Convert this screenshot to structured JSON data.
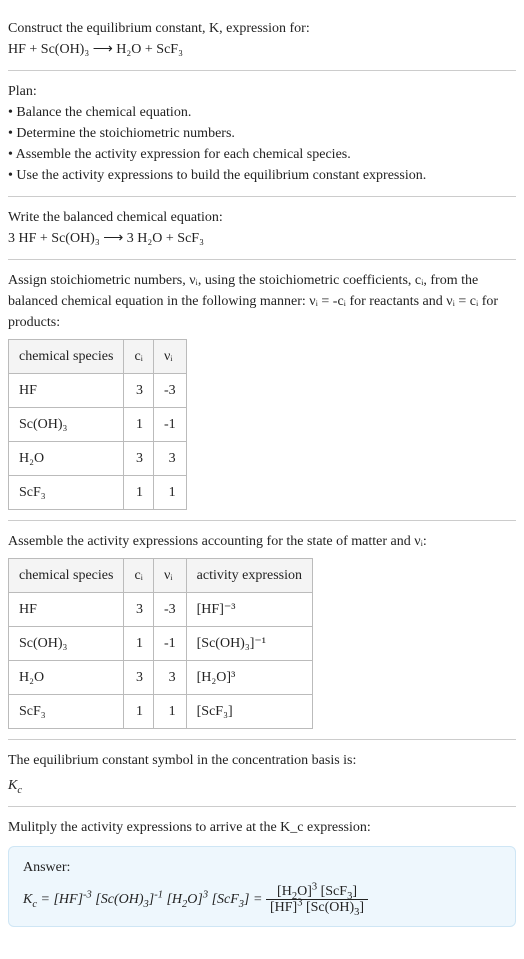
{
  "intro": {
    "line1": "Construct the equilibrium constant, K, expression for:",
    "equation": "HF + Sc(OH)₃ ⟶ H₂O + ScF₃"
  },
  "plan": {
    "heading": "Plan:",
    "items": [
      "• Balance the chemical equation.",
      "• Determine the stoichiometric numbers.",
      "• Assemble the activity expression for each chemical species.",
      "• Use the activity expressions to build the equilibrium constant expression."
    ]
  },
  "balanced": {
    "line1": "Write the balanced chemical equation:",
    "equation": "3 HF + Sc(OH)₃ ⟶ 3 H₂O + ScF₃"
  },
  "stoich": {
    "text": "Assign stoichiometric numbers, νᵢ, using the stoichiometric coefficients, cᵢ, from the balanced chemical equation in the following manner: νᵢ = -cᵢ for reactants and νᵢ = cᵢ for products:",
    "head": {
      "species": "chemical species",
      "c": "cᵢ",
      "v": "νᵢ"
    },
    "rows": [
      {
        "species": "HF",
        "c": "3",
        "v": "-3"
      },
      {
        "species": "Sc(OH)₃",
        "c": "1",
        "v": "-1"
      },
      {
        "species": "H₂O",
        "c": "3",
        "v": "3"
      },
      {
        "species": "ScF₃",
        "c": "1",
        "v": "1"
      }
    ]
  },
  "activity": {
    "text": "Assemble the activity expressions accounting for the state of matter and νᵢ:",
    "head": {
      "species": "chemical species",
      "c": "cᵢ",
      "v": "νᵢ",
      "ae": "activity expression"
    },
    "rows": [
      {
        "species": "HF",
        "c": "3",
        "v": "-3",
        "ae": "[HF]⁻³"
      },
      {
        "species": "Sc(OH)₃",
        "c": "1",
        "v": "-1",
        "ae": "[Sc(OH)₃]⁻¹"
      },
      {
        "species": "H₂O",
        "c": "3",
        "v": "3",
        "ae": "[H₂O]³"
      },
      {
        "species": "ScF₃",
        "c": "1",
        "v": "1",
        "ae": "[ScF₃]"
      }
    ]
  },
  "ksymbol": {
    "line1": "The equilibrium constant symbol in the concentration basis is:",
    "symbol": "K_c"
  },
  "multiply": {
    "text": "Mulitply the activity expressions to arrive at the K_c expression:"
  },
  "answer": {
    "label": "Answer:",
    "left": "K_c = [HF]⁻³ [Sc(OH)₃]⁻¹ [H₂O]³ [ScF₃] =",
    "frac_num": "[H₂O]³ [ScF₃]",
    "frac_den": "[HF]³ [Sc(OH)₃]"
  }
}
